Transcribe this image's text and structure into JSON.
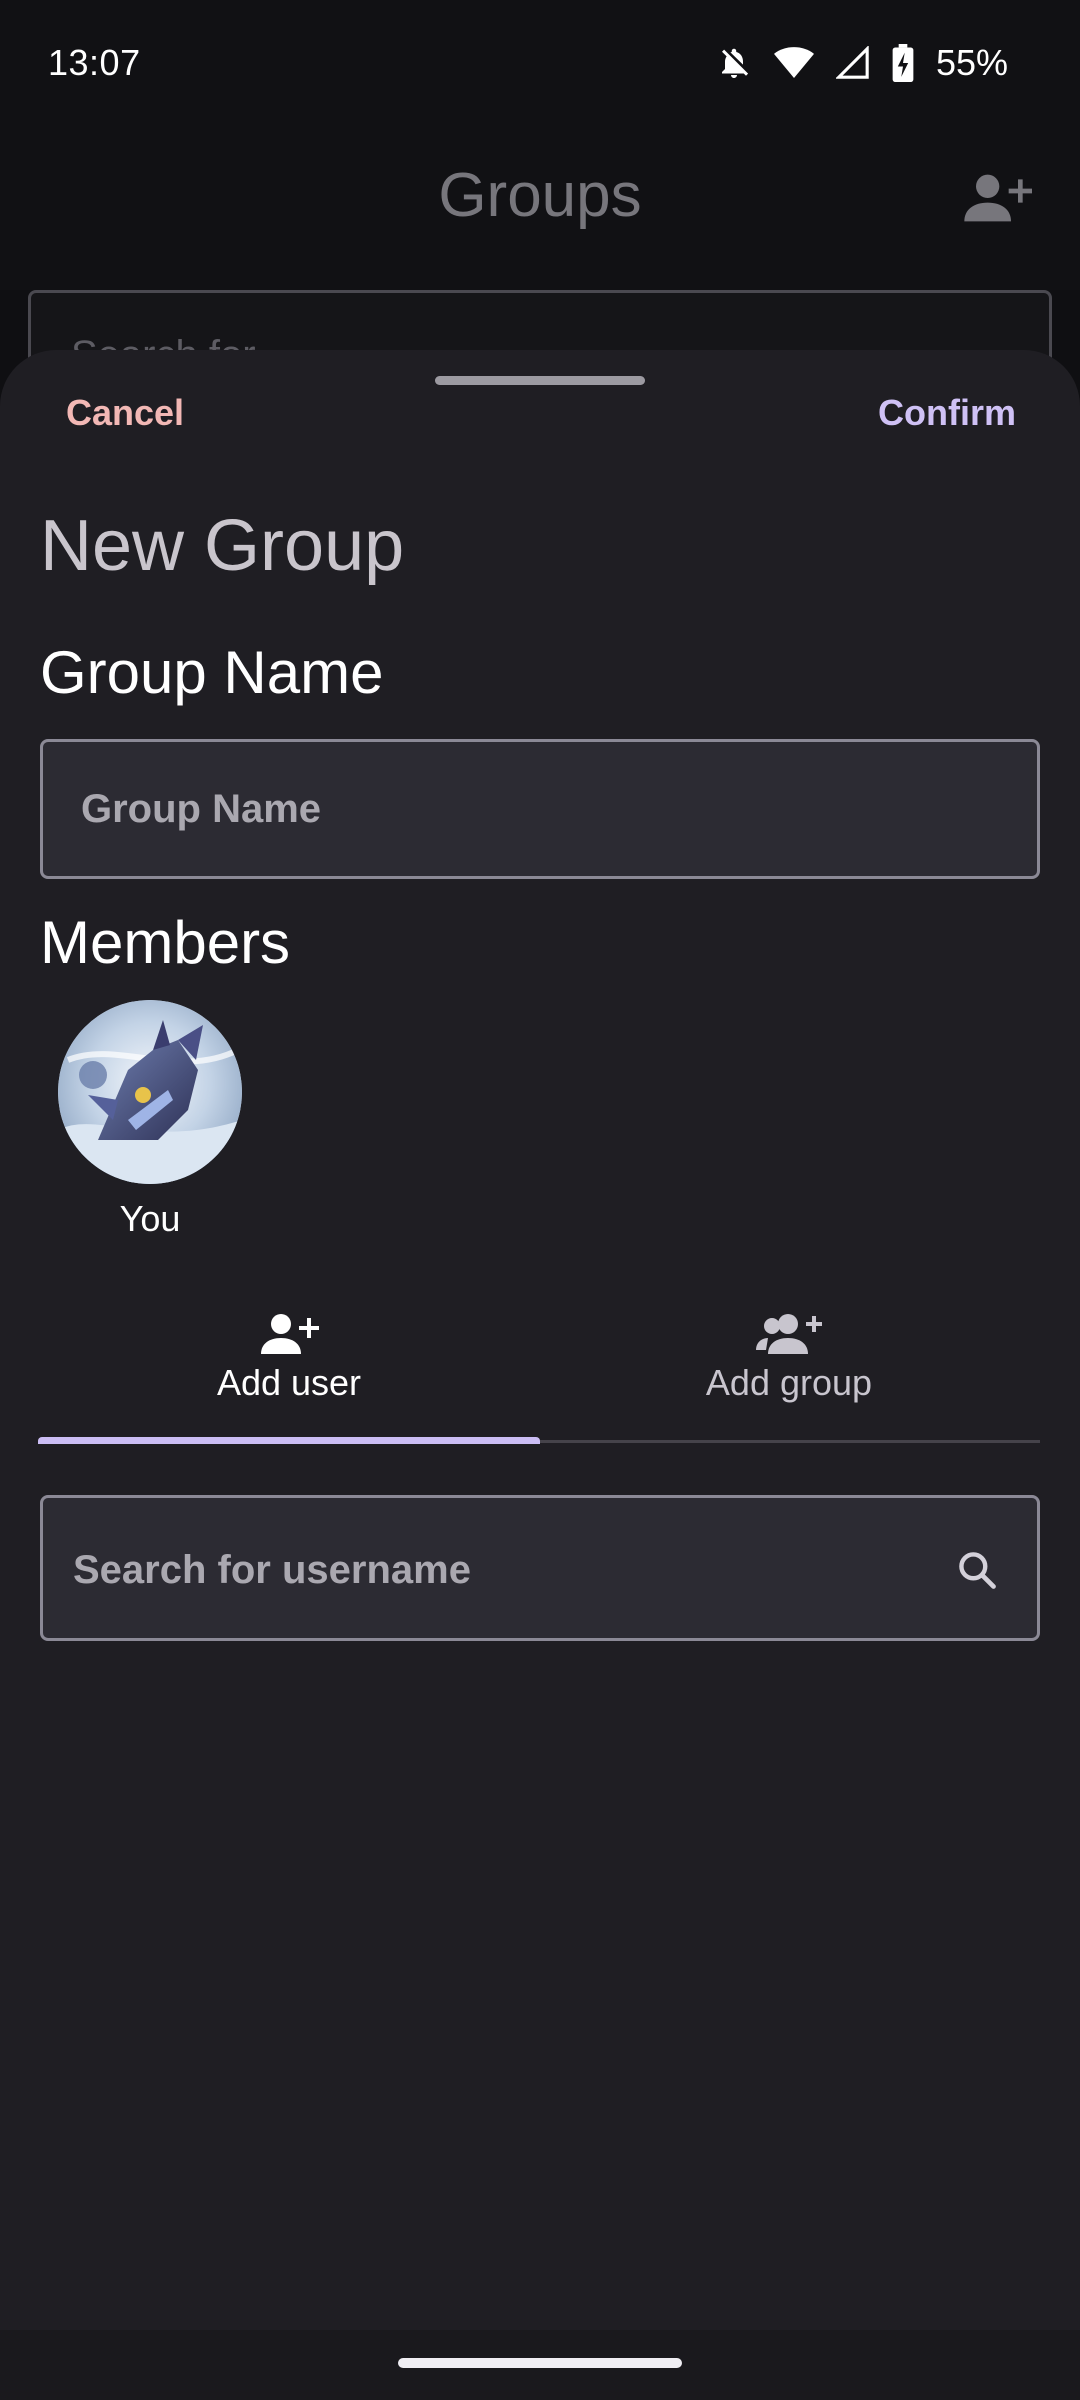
{
  "status_bar": {
    "time": "13:07",
    "battery": "55%",
    "icons": [
      "notifications-off-icon",
      "wifi-icon",
      "signal-icon",
      "battery-charging-icon"
    ]
  },
  "background": {
    "title": "Groups",
    "search_placeholder": "Search for..."
  },
  "sheet": {
    "cancel_label": "Cancel",
    "confirm_label": "Confirm",
    "title": "New Group",
    "group_name_heading": "Group Name",
    "group_name_placeholder": "Group Name",
    "members_heading": "Members",
    "members": [
      {
        "name": "You"
      }
    ],
    "tabs": [
      {
        "label": "Add user",
        "icon": "add-user-icon",
        "selected": true
      },
      {
        "label": "Add group",
        "icon": "add-group-icon",
        "selected": false
      }
    ],
    "search_placeholder": "Search for username"
  },
  "colors": {
    "accent": "#cbbdf4",
    "cancel": "#f2b8b5",
    "sheet_background": "#1f1e23"
  }
}
